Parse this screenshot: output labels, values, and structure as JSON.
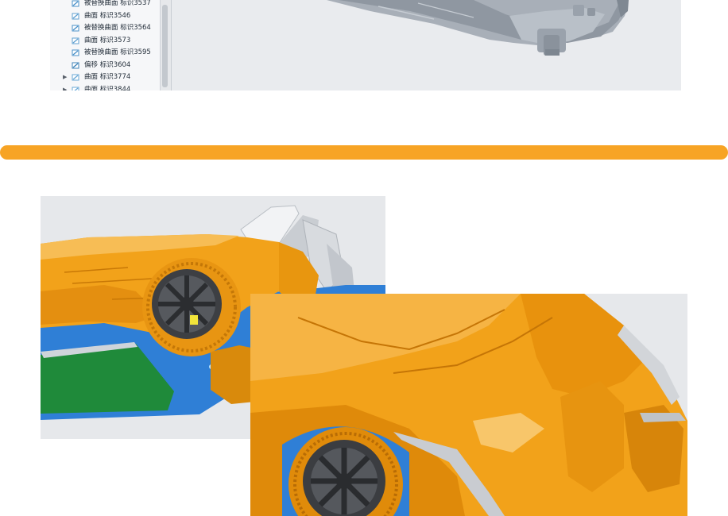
{
  "model_tree": {
    "items": [
      {
        "label": "被替换曲面 标识3537",
        "icon": "replaced-surface-icon",
        "expandable": false
      },
      {
        "label": "曲面 标识3546",
        "icon": "surface-icon",
        "expandable": false
      },
      {
        "label": "被替换曲面 标识3564",
        "icon": "replaced-surface-icon",
        "expandable": false
      },
      {
        "label": "曲面 标识3573",
        "icon": "surface-icon",
        "expandable": false
      },
      {
        "label": "被替换曲面 标识3595",
        "icon": "replaced-surface-icon",
        "expandable": false
      },
      {
        "label": "偏移 标识3604",
        "icon": "offset-icon",
        "expandable": false
      },
      {
        "label": "曲面 标识3774",
        "icon": "surface-group-icon",
        "expandable": true
      },
      {
        "label": "曲面 标识3844",
        "icon": "surface-group-icon",
        "expandable": true
      }
    ],
    "expander_glyph": "▶"
  },
  "colors": {
    "accent_bar": "#f7a425",
    "car_body": "#f2a21a",
    "mold_blue": "#2f7fd6",
    "mold_green": "#1f8a3a",
    "part_gray": "#a6adb6"
  }
}
